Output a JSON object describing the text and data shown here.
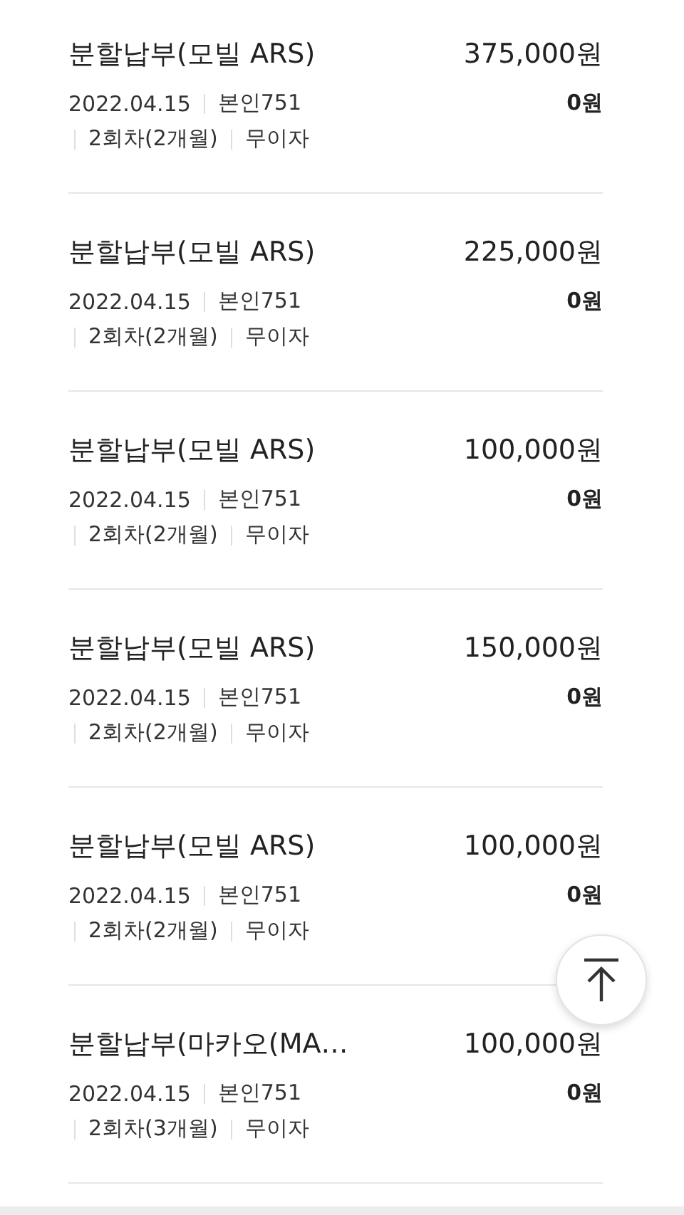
{
  "items": [
    {
      "title": "분할납부(모빌 ARS)",
      "amount": "375,000원",
      "date": "2022.04.15",
      "card": "본인751",
      "fee": "0원",
      "installment": "2회차(2개월)",
      "interest": "무이자"
    },
    {
      "title": "분할납부(모빌 ARS)",
      "amount": "225,000원",
      "date": "2022.04.15",
      "card": "본인751",
      "fee": "0원",
      "installment": "2회차(2개월)",
      "interest": "무이자"
    },
    {
      "title": "분할납부(모빌 ARS)",
      "amount": "100,000원",
      "date": "2022.04.15",
      "card": "본인751",
      "fee": "0원",
      "installment": "2회차(2개월)",
      "interest": "무이자"
    },
    {
      "title": "분할납부(모빌 ARS)",
      "amount": "150,000원",
      "date": "2022.04.15",
      "card": "본인751",
      "fee": "0원",
      "installment": "2회차(2개월)",
      "interest": "무이자"
    },
    {
      "title": "분할납부(모빌 ARS)",
      "amount": "100,000원",
      "date": "2022.04.15",
      "card": "본인751",
      "fee": "0원",
      "installment": "2회차(2개월)",
      "interest": "무이자"
    },
    {
      "title": "분할납부(마카오(MA…",
      "amount": "100,000원",
      "date": "2022.04.15",
      "card": "본인751",
      "fee": "0원",
      "installment": "2회차(3개월)",
      "interest": "무이자"
    }
  ]
}
